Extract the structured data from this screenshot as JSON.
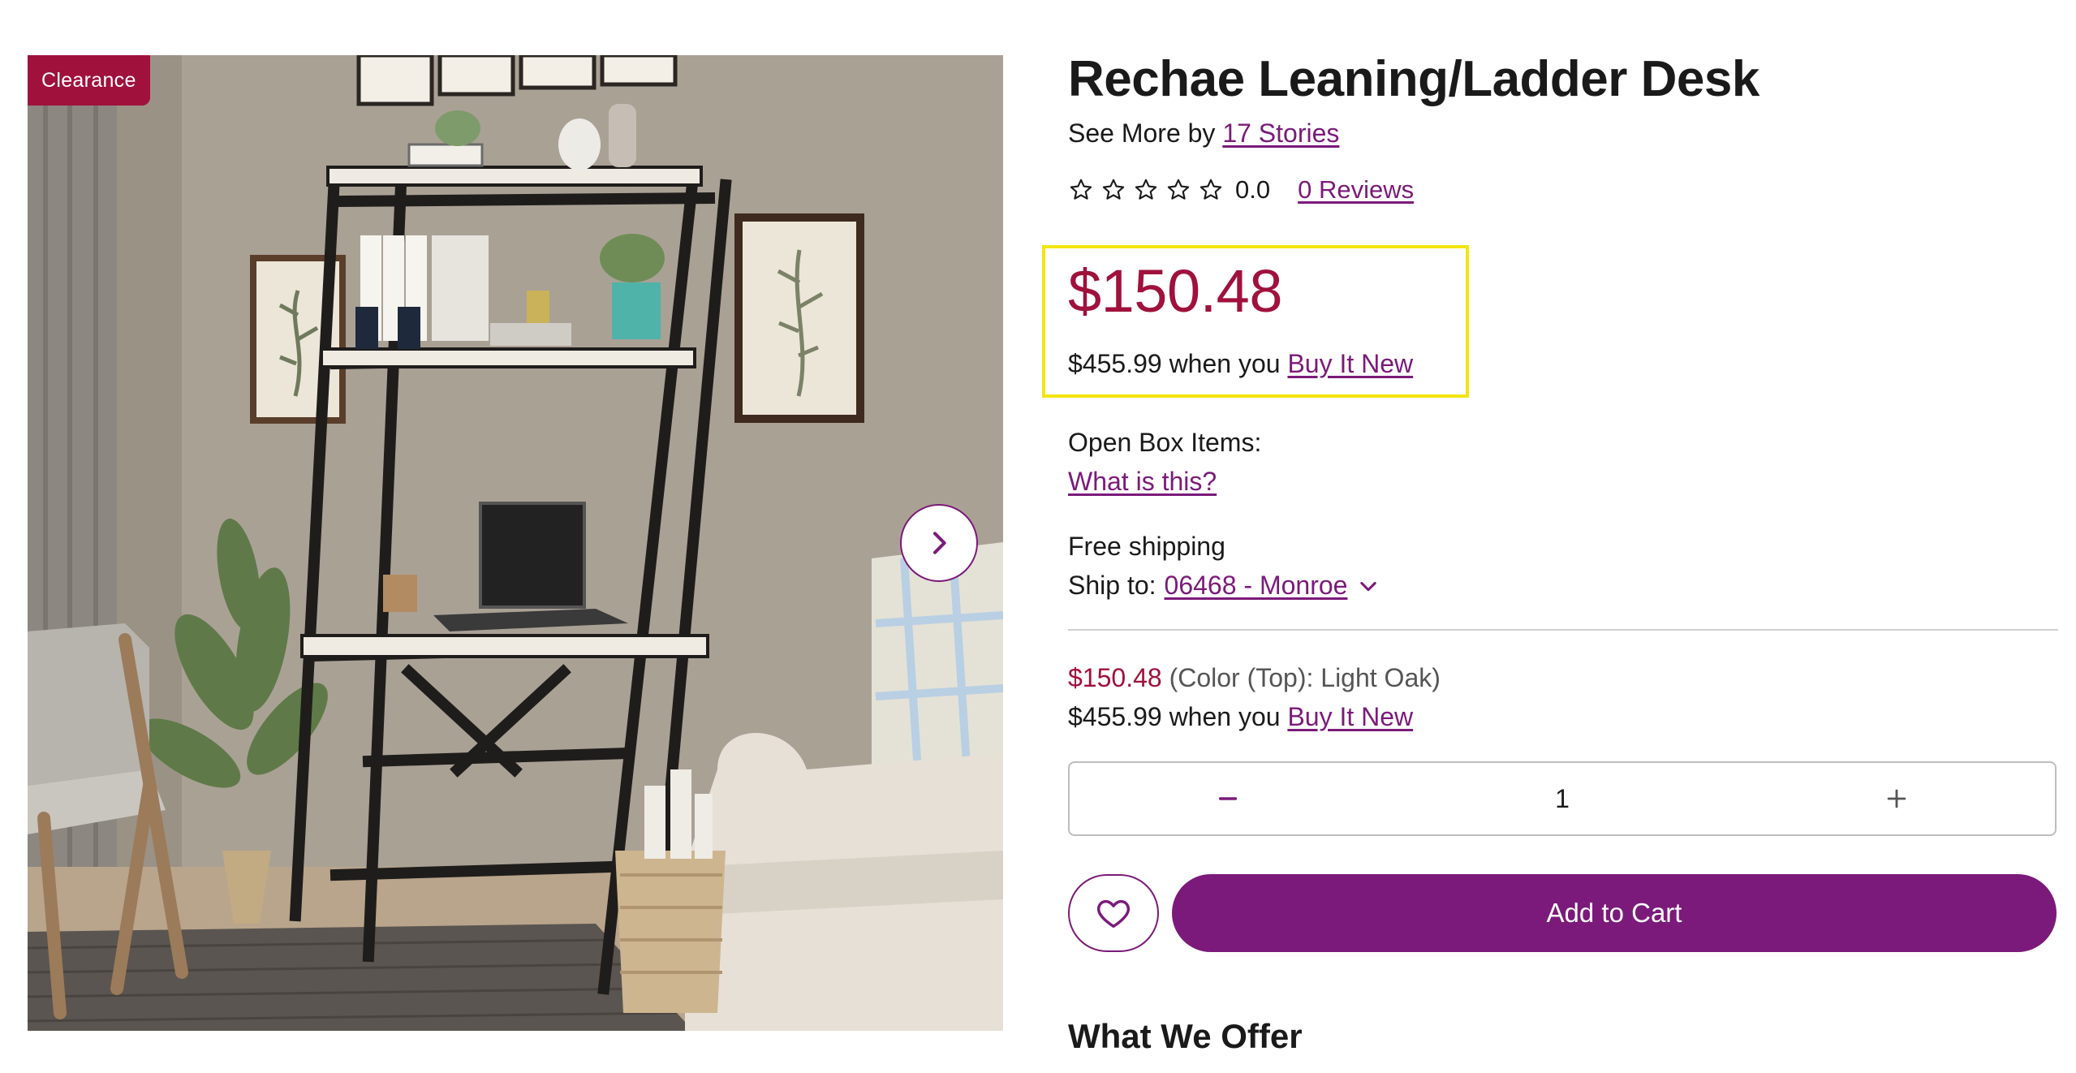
{
  "gallery": {
    "badge": "Clearance",
    "next_icon": "chevron-right-icon"
  },
  "product": {
    "title": "Rechae Leaning/Ladder Desk",
    "see_more_prefix": "See More by",
    "brand": "17 Stories",
    "rating_value": "0.0",
    "stars_filled": 0,
    "stars_total": 5,
    "reviews_link": "0 Reviews"
  },
  "price": {
    "current": "$150.48",
    "new_price": "$455.99",
    "new_suffix": "when you",
    "buy_new_link": "Buy It New"
  },
  "open_box": {
    "label": "Open Box Items:",
    "link": "What is this?"
  },
  "shipping": {
    "label": "Free shipping",
    "ship_to_label": "Ship to:",
    "location": "06468 - Monroe"
  },
  "variant": {
    "price": "$150.48",
    "option": "(Color (Top): Light Oak)",
    "new_price": "$455.99",
    "new_suffix": "when you",
    "buy_new_link": "Buy It New"
  },
  "quantity": {
    "value": "1"
  },
  "actions": {
    "add_to_cart": "Add to Cart"
  },
  "section": {
    "what_we_offer": "What We Offer"
  },
  "colors": {
    "accent_purple": "#7b1a7a",
    "price_red": "#a0113c",
    "highlight_yellow": "#f2e50f"
  }
}
